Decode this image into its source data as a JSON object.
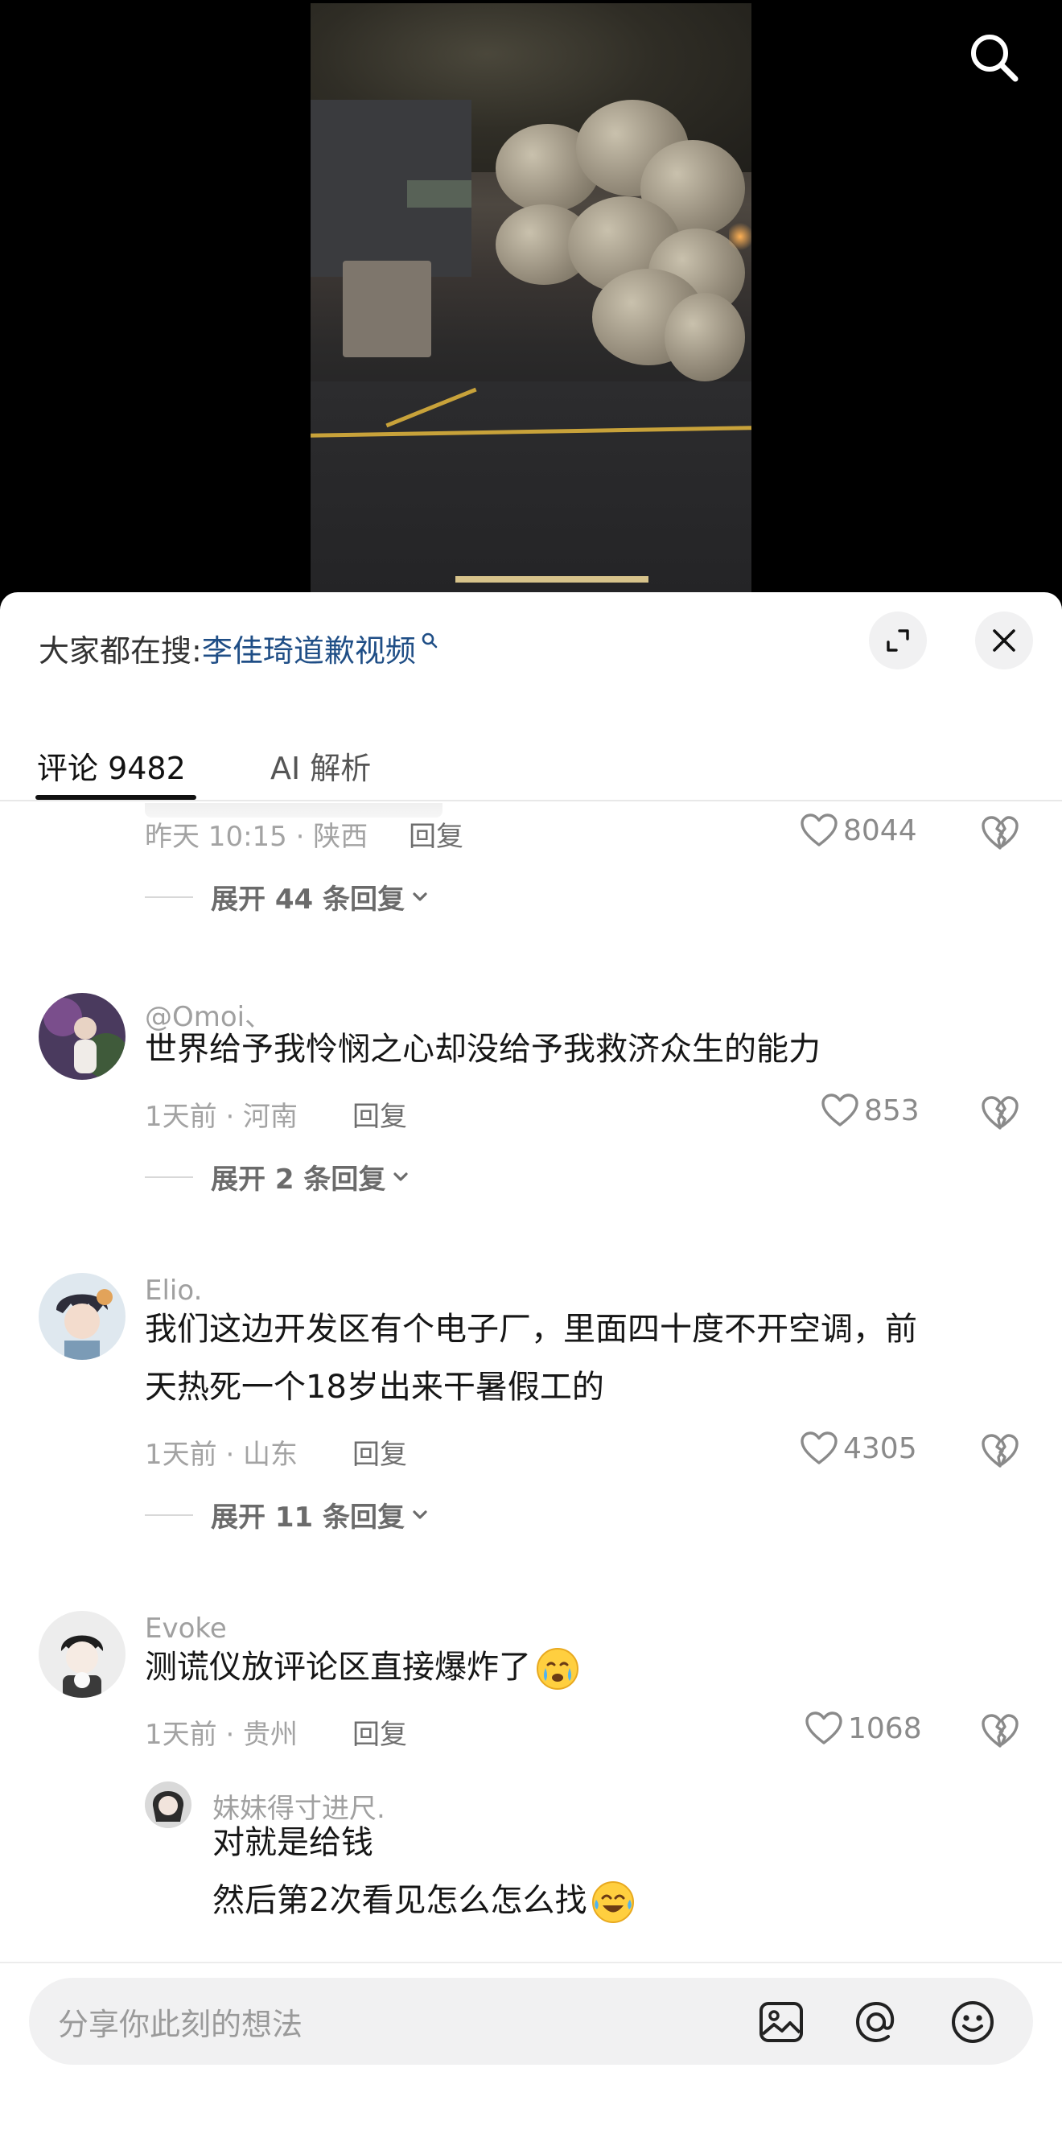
{
  "top": {
    "search_icon": "search-icon"
  },
  "sheet": {
    "trending_prefix": "大家都在搜:",
    "trending_link": "李佳琦道歉视频",
    "tabs": [
      {
        "label": "评论 9482",
        "active": true
      },
      {
        "label": "AI 解析",
        "active": false
      }
    ],
    "first_meta": {
      "time_location": "昨天 10:15 · 陕西",
      "reply": "回复",
      "likes": "8044",
      "expand": "展开 44 条回复"
    },
    "comments": [
      {
        "username": "@Omoi、",
        "lines": [
          "世界给予我怜悯之心却没给予我救济众生的能力"
        ],
        "time_location": "1天前 · 河南",
        "reply": "回复",
        "likes": "853",
        "expand": "展开 2 条回复"
      },
      {
        "username": "Elio.",
        "lines": [
          "我们这边开发区有个电子厂，里面四十度不开空调，前",
          "天热死一个18岁出来干暑假工的"
        ],
        "time_location": "1天前 · 山东",
        "reply": "回复",
        "likes": "4305",
        "expand": "展开 11 条回复"
      },
      {
        "username": "Evoke",
        "lines": [
          "测谎仪放评论区直接爆炸了"
        ],
        "time_location": "1天前 · 贵州",
        "reply": "回复",
        "likes": "1068"
      }
    ],
    "sub_reply": {
      "username": "妹妹得寸进尺.",
      "lines": [
        "对就是给钱",
        "然后第2次看见怎么怎么找"
      ]
    },
    "input": {
      "placeholder": "分享你此刻的想法"
    }
  },
  "colors": {
    "link": "#1f4e86",
    "muted": "#a3a3a3",
    "text": "#161616"
  }
}
